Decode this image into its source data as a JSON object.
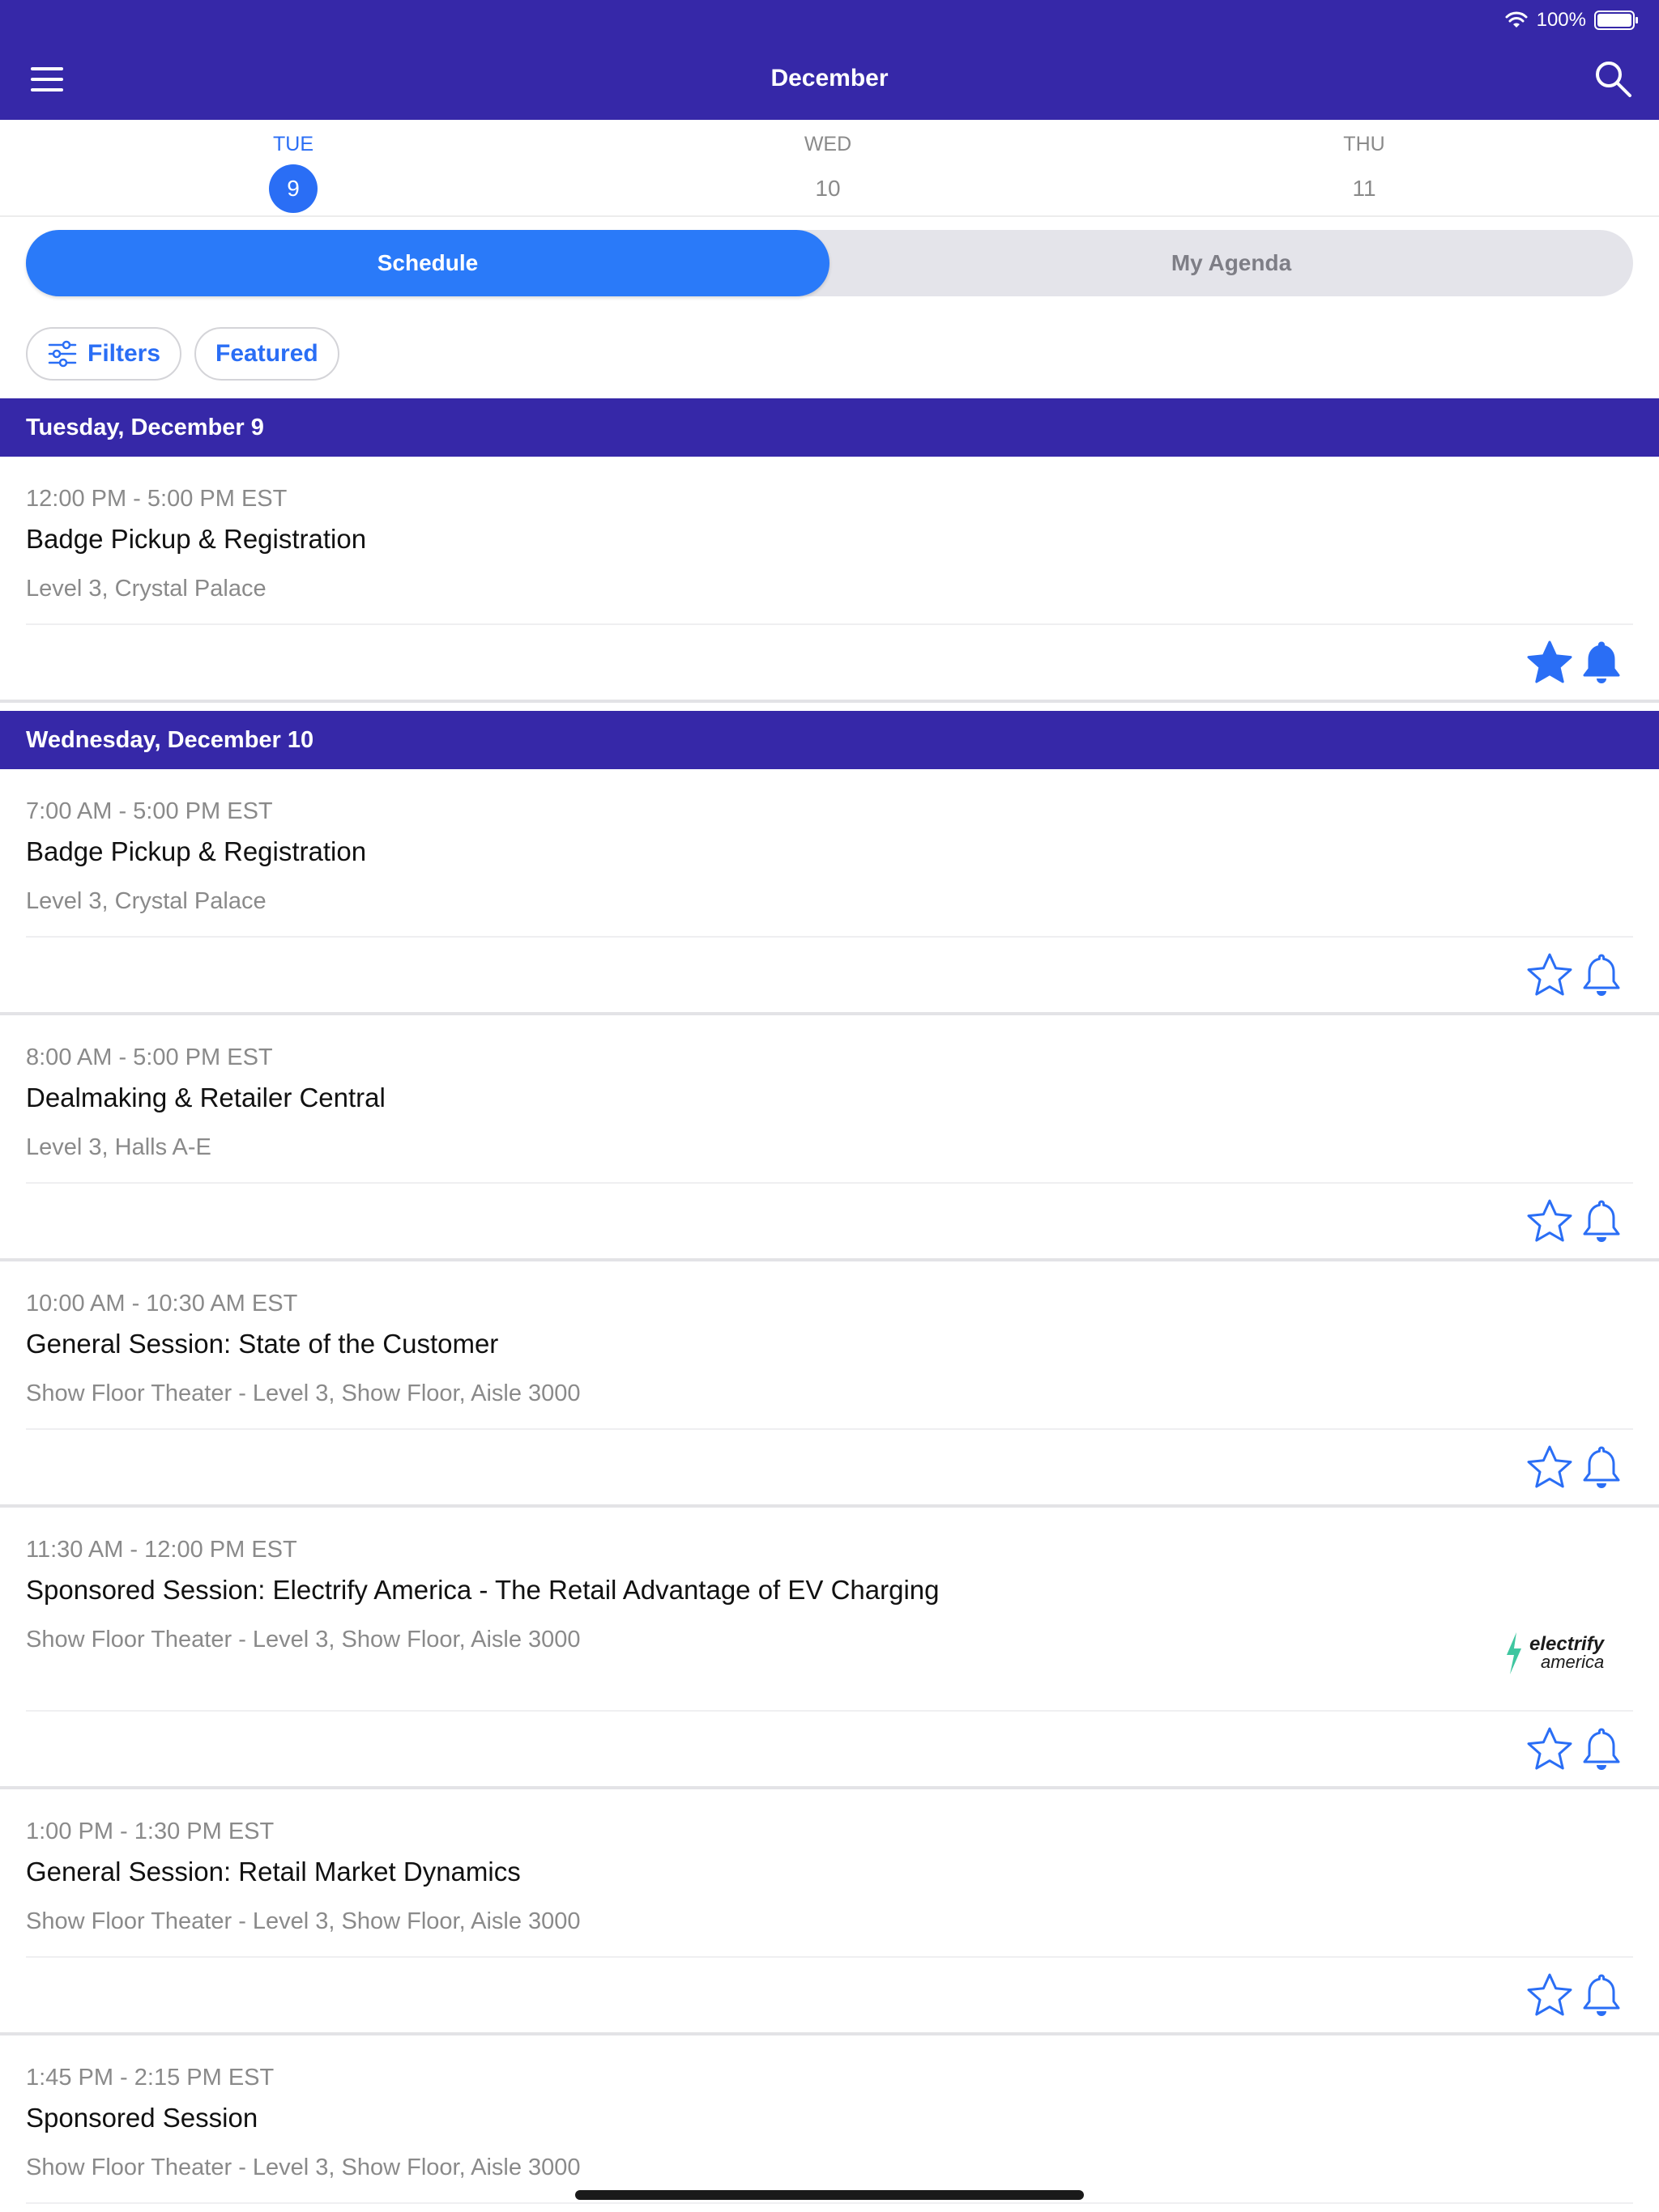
{
  "status": {
    "battery": "100%"
  },
  "header": {
    "title": "December"
  },
  "days": [
    {
      "dow": "TUE",
      "num": "9"
    },
    {
      "dow": "WED",
      "num": "10"
    },
    {
      "dow": "THU",
      "num": "11"
    }
  ],
  "segment": {
    "schedule": "Schedule",
    "agenda": "My Agenda"
  },
  "chips": {
    "filters": "Filters",
    "featured": "Featured"
  },
  "groups": [
    {
      "header": "Tuesday, December 9",
      "sessions": [
        {
          "time": "12:00 PM - 5:00 PM EST",
          "name": "Badge Pickup & Registration",
          "location": "Level 3, Crystal Palace",
          "starred": true,
          "alert": true
        }
      ]
    },
    {
      "header": "Wednesday, December 10",
      "sessions": [
        {
          "time": "7:00 AM - 5:00 PM EST",
          "name": "Badge Pickup & Registration",
          "location": "Level 3, Crystal Palace",
          "starred": false,
          "alert": false
        },
        {
          "time": "8:00 AM - 5:00 PM EST",
          "name": "Dealmaking & Retailer Central",
          "location": "Level 3, Halls A-E",
          "starred": false,
          "alert": false
        },
        {
          "time": "10:00 AM - 10:30 AM EST",
          "name": "General Session: State of the Customer",
          "location": "Show Floor Theater - Level 3, Show Floor, Aisle 3000",
          "starred": false,
          "alert": false
        },
        {
          "time": "11:30 AM - 12:00 PM EST",
          "name": "Sponsored Session: Electrify America - The Retail Advantage of EV Charging",
          "location": "Show Floor Theater - Level 3, Show Floor, Aisle 3000",
          "starred": false,
          "alert": false,
          "sponsor": {
            "line1": "electrify",
            "line2": "america"
          }
        },
        {
          "time": "1:00 PM - 1:30 PM EST",
          "name": "General Session: Retail Market Dynamics",
          "location": "Show Floor Theater - Level 3, Show Floor, Aisle 3000",
          "starred": false,
          "alert": false
        },
        {
          "time": "1:45 PM - 2:15 PM EST",
          "name": "Sponsored Session",
          "location": "Show Floor Theater - Level 3, Show Floor, Aisle 3000",
          "starred": false,
          "alert": false
        }
      ]
    }
  ],
  "colors": {
    "primary": "#3628a8",
    "accent": "#2a6ef5"
  },
  "icons": {
    "menu": "hamburger-icon",
    "search": "search-icon",
    "filter": "sliders-icon",
    "star": "star-icon",
    "bell": "bell-icon",
    "wifi": "wifi-icon",
    "battery": "battery-icon"
  }
}
